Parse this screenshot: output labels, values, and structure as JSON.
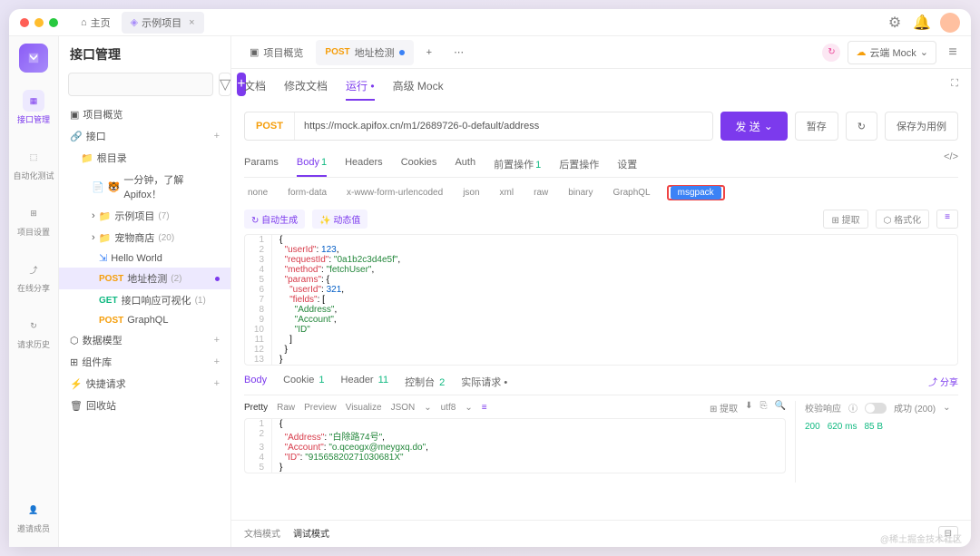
{
  "titlebar": {
    "home": "主页",
    "activeTab": "示例项目"
  },
  "rail": {
    "items": [
      "接口管理",
      "自动化测试",
      "项目设置",
      "在线分享",
      "请求历史",
      "邀请成员"
    ]
  },
  "sidebar": {
    "title": "接口管理",
    "searchPlaceholder": "",
    "overview": "项目概览",
    "api": "接口",
    "root": "根目录",
    "quickstart": "一分钟，了解 Apifox！",
    "sample": "示例项目",
    "sampleCount": "(7)",
    "petstore": "宠物商店",
    "petstoreCount": "(20)",
    "hello": "Hello World",
    "addr": "地址检测",
    "addrCount": "(2)",
    "vis": "接口响应可视化",
    "visCount": "(1)",
    "graphql": "GraphQL",
    "datamodel": "数据模型",
    "components": "组件库",
    "quickreq": "快捷请求",
    "trash": "回收站"
  },
  "mainTabs": {
    "overview": "项目概览",
    "addr": "地址检测",
    "method": "POST"
  },
  "env": {
    "label": "云端 Mock"
  },
  "docTabs": {
    "doc": "文档",
    "edit": "修改文档",
    "run": "运行",
    "mock": "高级 Mock"
  },
  "url": {
    "method": "POST",
    "value": "https://mock.apifox.cn/m1/2689726-0-default/address"
  },
  "buttons": {
    "send": "发 送",
    "tempSave": "暂存",
    "saveCase": "保存为用例"
  },
  "paramTabs": {
    "params": "Params",
    "body": "Body",
    "headers": "Headers",
    "cookies": "Cookies",
    "auth": "Auth",
    "pre": "前置操作",
    "post": "后置操作",
    "settings": "设置"
  },
  "bodyTypes": [
    "none",
    "form-data",
    "x-www-form-urlencoded",
    "json",
    "xml",
    "raw",
    "binary",
    "GraphQL",
    "msgpack"
  ],
  "bodyActions": {
    "auto": "自动生成",
    "dynamic": "动态值",
    "extract": "提取",
    "format": "格式化"
  },
  "reqBody": {
    "lines": [
      "{",
      "  \"userId\": 123,",
      "  \"requestId\": \"0a1b2c3d4e5f\",",
      "  \"method\": \"fetchUser\",",
      "  \"params\": {",
      "    \"userId\": 321,",
      "    \"fields\": [",
      "      \"Address\",",
      "      \"Account\",",
      "      \"ID\"",
      "    ]",
      "  }",
      "}"
    ]
  },
  "respTabs": {
    "body": "Body",
    "cookie": "Cookie",
    "cookieN": "1",
    "header": "Header",
    "headerN": "11",
    "console": "控制台",
    "consoleN": "2",
    "actual": "实际请求",
    "share": "分享"
  },
  "respToolbar": {
    "pretty": "Pretty",
    "raw": "Raw",
    "preview": "Preview",
    "visualize": "Visualize",
    "json": "JSON",
    "utf8": "utf8",
    "extract": "提取"
  },
  "respBody": {
    "lines": [
      "{",
      "  \"Address\": \"白除路74号\",",
      "  \"Account\": \"o.qceogx@meygxq.do\",",
      "  \"ID\": \"91565820271030681X\"",
      "}"
    ]
  },
  "respSide": {
    "validate": "校验响应",
    "status": "成功 (200)",
    "code": "200",
    "time": "620 ms",
    "size": "85 B"
  },
  "footer": {
    "docMode": "文档模式",
    "debugMode": "调试模式"
  },
  "watermark": "@稀土掘金技术社区"
}
